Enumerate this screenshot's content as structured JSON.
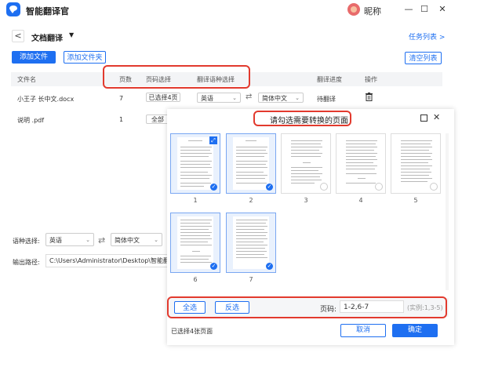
{
  "app": {
    "title": "智能翻译官",
    "user_name": "昵称",
    "minimize": "—",
    "maximize": "☐",
    "close": "✕"
  },
  "nav": {
    "back": "<",
    "title": "文档翻译",
    "dropdown": "▼",
    "task_list": "任务列表 >"
  },
  "toolbar": {
    "add_file": "添加文件",
    "add_folder": "添加文件夹",
    "clear_list": "清空列表"
  },
  "table": {
    "headers": {
      "name": "文件名",
      "pages": "页数",
      "page_select": "页码选择",
      "lang_select": "翻译语种选择",
      "progress": "翻译进度",
      "action": "操作"
    },
    "rows": [
      {
        "name": "小王子 长中文.docx",
        "pages": "7",
        "page_select": "已选择4页",
        "from_lang": "英语",
        "to_lang": "简体中文",
        "progress": "待翻译",
        "action_icon": "trash-icon"
      },
      {
        "name": "说明 .pdf",
        "pages": "1",
        "page_select": "全部"
      }
    ]
  },
  "footer": {
    "lang_label": "语种选择:",
    "from_lang": "英语",
    "to_lang": "简体中文",
    "path_label": "输出路径:",
    "path_value": "C:\\Users\\Administrator\\Desktop\\智能翻译"
  },
  "dialog": {
    "title": "请勾选需要转换的页面",
    "pages": [
      {
        "num": "1",
        "selected": true
      },
      {
        "num": "2",
        "selected": true
      },
      {
        "num": "3",
        "selected": false
      },
      {
        "num": "4",
        "selected": false
      },
      {
        "num": "5",
        "selected": false
      },
      {
        "num": "6",
        "selected": true
      },
      {
        "num": "7",
        "selected": true
      }
    ],
    "select_all": "全选",
    "invert": "反选",
    "page_code_label": "页码:",
    "page_code_value": "1-2,6-7",
    "page_code_hint": "(实例:1,3-5)",
    "status": "已选择4张页面",
    "cancel": "取消",
    "confirm": "确定"
  },
  "colors": {
    "accent": "#1e6ff1",
    "highlight": "#e23a2e"
  }
}
